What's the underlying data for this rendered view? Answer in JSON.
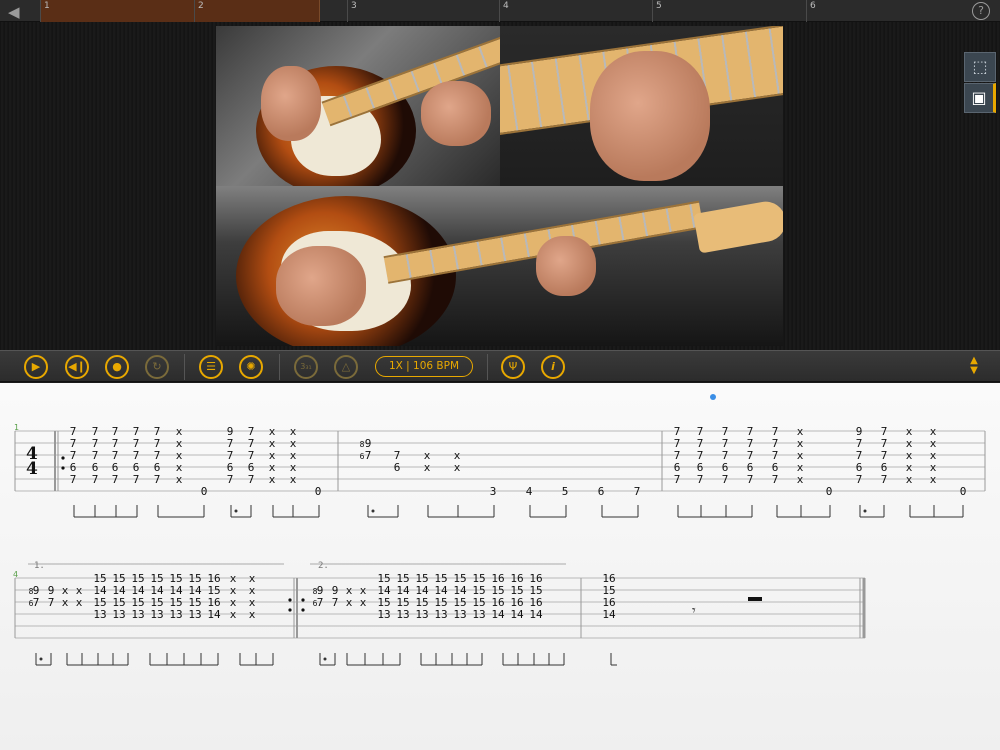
{
  "timeline": {
    "back_icon": "back-arrow-icon",
    "progress_percent": 32,
    "markers": [
      "1",
      "2",
      "3",
      "4",
      "5",
      "6"
    ],
    "help_label": "?"
  },
  "video": {
    "panes": [
      "strumming-hand-view",
      "fretting-hand-closeup",
      "full-guitar-view"
    ]
  },
  "side_views": {
    "view_3d_icon": "cube-icon",
    "view_video_icon": "film-icon"
  },
  "toolbar": {
    "speed_label": "1X | 106 BPM",
    "countin_label": "3₃₁",
    "info_label": "i",
    "accent_color": "#e8a800"
  },
  "score": {
    "time_signature": {
      "top": "4",
      "bottom": "4"
    },
    "system1_measure_start": "1",
    "system2_measure_start": "4",
    "volta1": "1.",
    "volta2": "2.",
    "playhead_color": "#3a8ee6"
  }
}
